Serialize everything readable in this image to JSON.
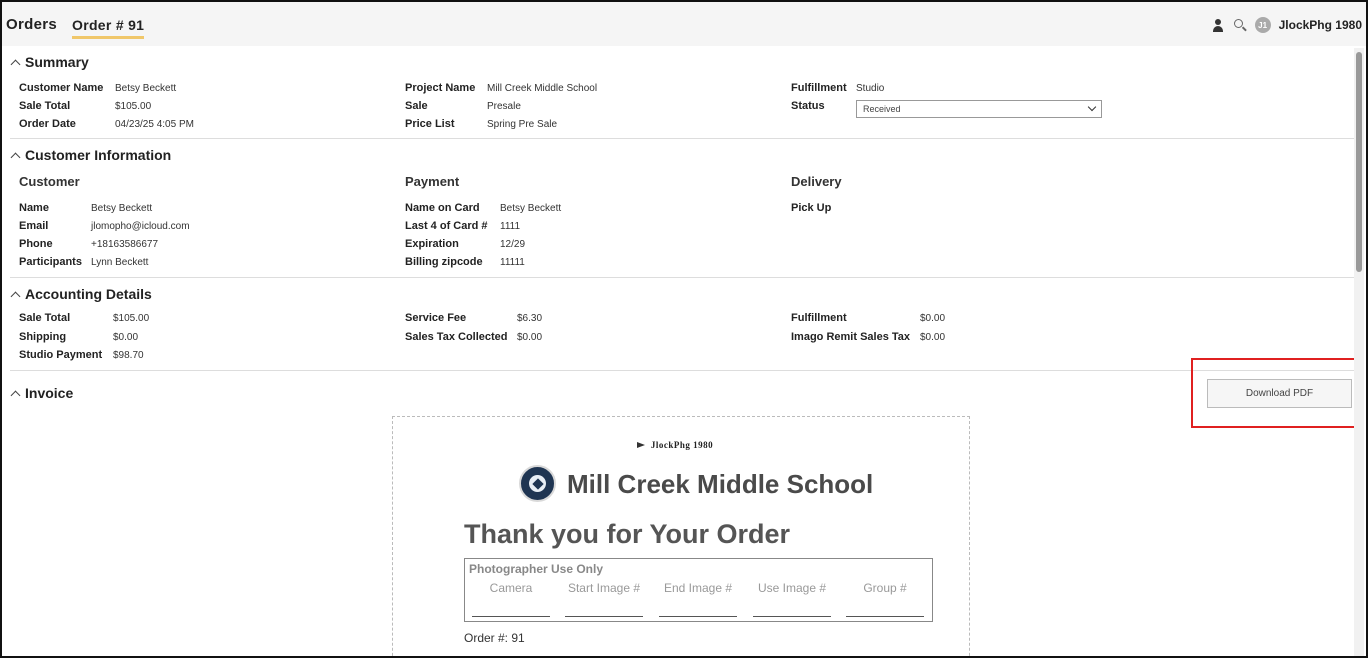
{
  "header": {
    "tab_orders": "Orders",
    "tab_order": "Order # 91",
    "avatar_initials": "J1",
    "username": "JlockPhg 1980"
  },
  "summary": {
    "title": "Summary",
    "customer_name_label": "Customer Name",
    "customer_name": "Betsy Beckett",
    "sale_total_label": "Sale Total",
    "sale_total": "$105.00",
    "order_date_label": "Order Date",
    "order_date": "04/23/25 4:05 PM",
    "project_name_label": "Project Name",
    "project_name": "Mill Creek Middle School",
    "sale_label": "Sale",
    "sale": "Presale",
    "price_list_label": "Price List",
    "price_list": "Spring Pre Sale",
    "fulfillment_label": "Fulfillment",
    "fulfillment": "Studio",
    "status_label": "Status",
    "status_value": "Received"
  },
  "customer_info": {
    "title": "Customer Information",
    "customer_heading": "Customer",
    "name_label": "Name",
    "name": "Betsy Beckett",
    "email_label": "Email",
    "email": "jlomopho@icloud.com",
    "phone_label": "Phone",
    "phone": "+18163586677",
    "participants_label": "Participants",
    "participants": "Lynn Beckett",
    "payment_heading": "Payment",
    "name_on_card_label": "Name on Card",
    "name_on_card": "Betsy Beckett",
    "last4_label": "Last 4 of Card #",
    "last4": "1111",
    "expiration_label": "Expiration",
    "expiration": "12/29",
    "billing_zip_label": "Billing zipcode",
    "billing_zip": "11111",
    "delivery_heading": "Delivery",
    "delivery_method": "Pick Up"
  },
  "accounting": {
    "title": "Accounting Details",
    "sale_total_label": "Sale Total",
    "sale_total": "$105.00",
    "shipping_label": "Shipping",
    "shipping": "$0.00",
    "studio_payment_label": "Studio Payment",
    "studio_payment": "$98.70",
    "service_fee_label": "Service Fee",
    "service_fee": "$6.30",
    "sales_tax_label": "Sales Tax Collected",
    "sales_tax": "$0.00",
    "fulfillment_label": "Fulfillment",
    "fulfillment": "$0.00",
    "imago_remit_label": "Imago Remit Sales Tax",
    "imago_remit": "$0.00"
  },
  "invoice": {
    "title": "Invoice",
    "download_label": "Download PDF",
    "studio_name": "JlockPhg 1980",
    "school_name": "Mill Creek Middle School",
    "thanks": "Thank you for Your Order",
    "photographer_title": "Photographer Use Only",
    "columns": [
      "Camera",
      "Start Image #",
      "End Image #",
      "Use Image #",
      "Group #"
    ],
    "order_number": "Order #: 91"
  }
}
